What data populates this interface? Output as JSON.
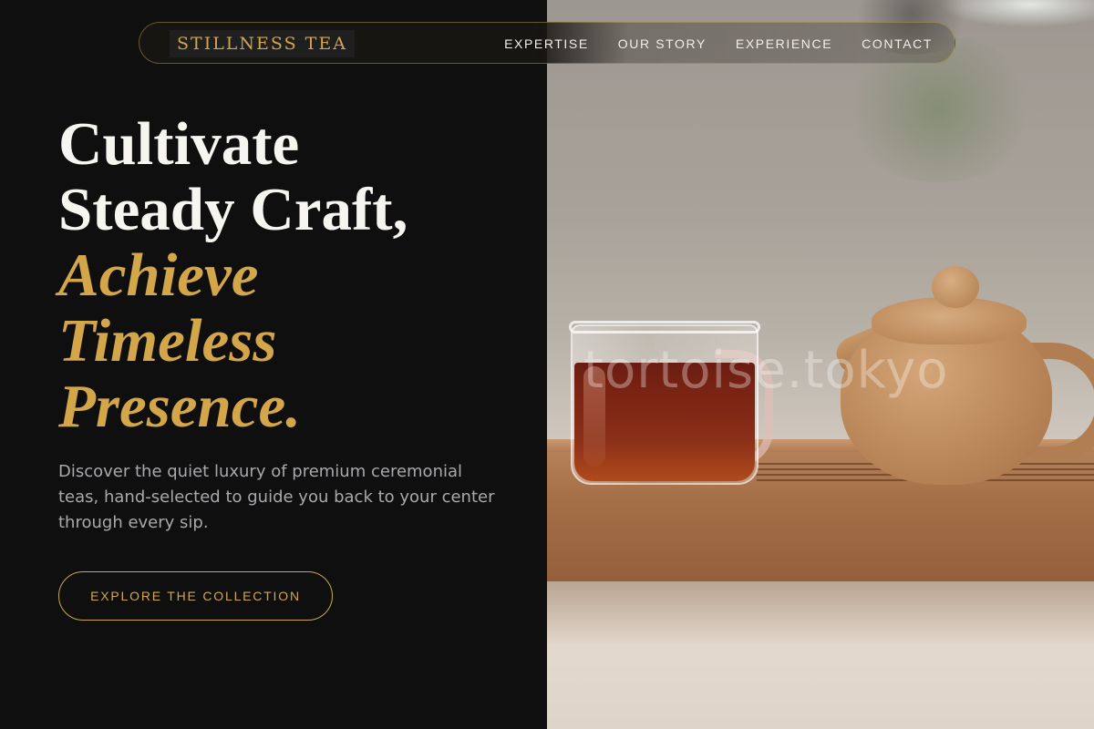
{
  "brand": {
    "name": "STILLNESS TEA"
  },
  "nav": {
    "items": [
      {
        "label": "EXPERTISE"
      },
      {
        "label": "OUR STORY"
      },
      {
        "label": "EXPERIENCE"
      },
      {
        "label": "CONTACT"
      }
    ]
  },
  "hero": {
    "lines": [
      "Cultivate",
      "Steady Craft,"
    ],
    "accent_lines": [
      "Achieve",
      "Timeless",
      "Presence."
    ],
    "description": "Discover the quiet luxury of premium ceremonial teas, hand-selected to guide you back to your center through every sip.",
    "cta_label": "EXPLORE THE COLLECTION"
  },
  "photo": {
    "watermark": "tortoise.tokyo"
  },
  "colors": {
    "background": "#0f0f0f",
    "accent_gold": "#d4a64a",
    "text_light": "#f7f5f0",
    "text_muted": "#a7a9ad"
  }
}
